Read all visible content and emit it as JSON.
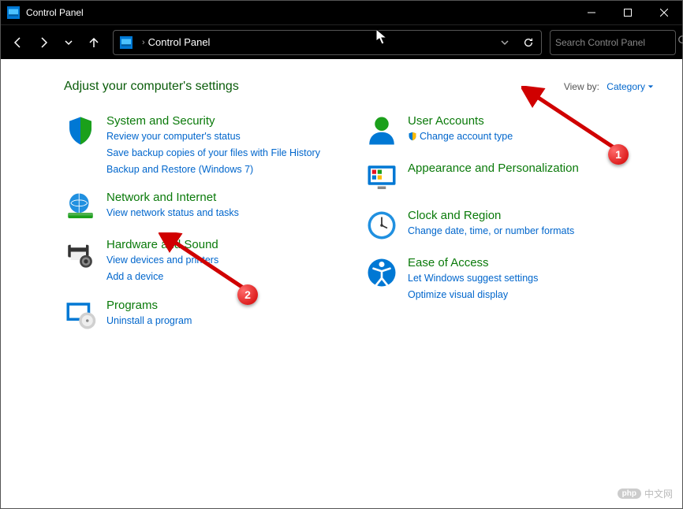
{
  "window": {
    "title": "Control Panel"
  },
  "address": {
    "path": "Control Panel"
  },
  "search": {
    "placeholder": "Search Control Panel"
  },
  "heading": "Adjust your computer's settings",
  "viewby": {
    "label": "View by:",
    "value": "Category"
  },
  "left_categories": [
    {
      "title": "System and Security",
      "links": [
        "Review your computer's status",
        "Save backup copies of your files with File History",
        "Backup and Restore (Windows 7)"
      ],
      "icon": "shield"
    },
    {
      "title": "Network and Internet",
      "links": [
        "View network status and tasks"
      ],
      "icon": "globe"
    },
    {
      "title": "Hardware and Sound",
      "links": [
        "View devices and printers",
        "Add a device"
      ],
      "icon": "printer"
    },
    {
      "title": "Programs",
      "links": [
        "Uninstall a program"
      ],
      "icon": "programs"
    }
  ],
  "right_categories": [
    {
      "title": "User Accounts",
      "links": [
        "Change account type"
      ],
      "icon": "user",
      "shield_on_first": true
    },
    {
      "title": "Appearance and Personalization",
      "links": [],
      "icon": "monitor"
    },
    {
      "title": "Clock and Region",
      "links": [
        "Change date, time, or number formats"
      ],
      "icon": "clock"
    },
    {
      "title": "Ease of Access",
      "links": [
        "Let Windows suggest settings",
        "Optimize visual display"
      ],
      "icon": "access"
    }
  ],
  "annotations": {
    "badge1": "1",
    "badge2": "2"
  },
  "watermark": {
    "brand": "php",
    "text": "中文网"
  }
}
